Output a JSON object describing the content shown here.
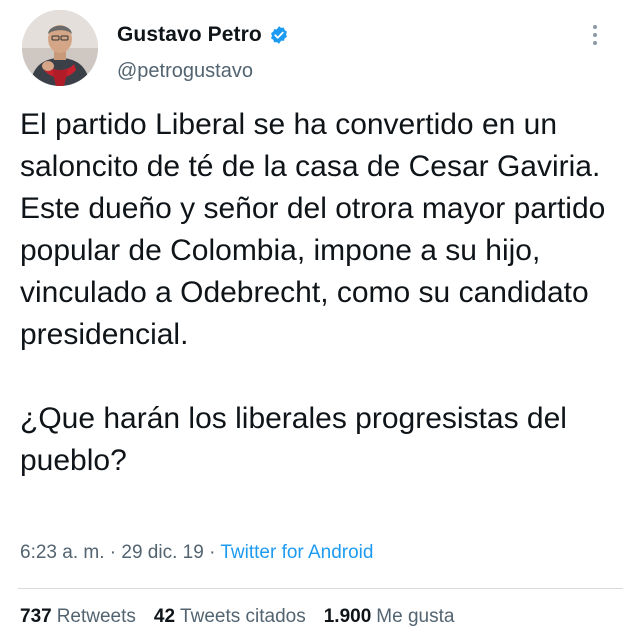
{
  "author": {
    "display_name": "Gustavo Petro",
    "handle": "@petrogustavo",
    "verified": true
  },
  "tweet": {
    "paragraphs": [
      "El partido Liberal se ha convertido en un saloncito de té de la casa de Cesar Gaviria. Este dueño y señor del otrora mayor partido popular de Colombia, impone a su hijo, vinculado a Odebrecht, como su candidato presidencial.",
      "¿Que harán los liberales progresistas del pueblo?"
    ]
  },
  "meta": {
    "time": "6:23 a. m.",
    "separator": " · ",
    "date": "29 dic. 19",
    "source": "Twitter for Android"
  },
  "stats": [
    {
      "count": "737",
      "label": "Retweets"
    },
    {
      "count": "42",
      "label": "Tweets citados"
    },
    {
      "count": "1.900",
      "label": "Me gusta"
    }
  ],
  "colors": {
    "verified_badge": "#1d9bf0",
    "link": "#1d9bf0",
    "secondary_text": "#536471",
    "primary_text": "#0f1419"
  },
  "icons": {
    "verified": "verified-badge-icon",
    "more": "more-options-icon"
  }
}
